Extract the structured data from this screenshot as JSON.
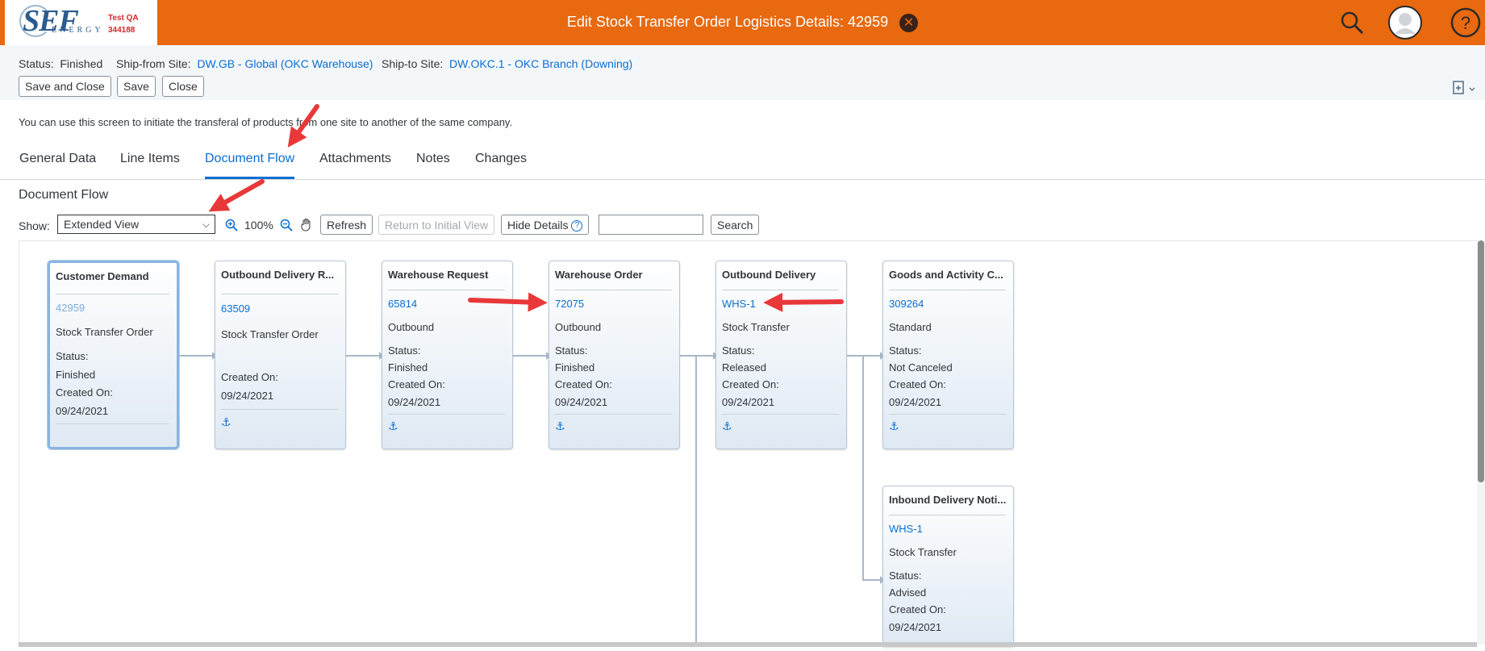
{
  "header": {
    "logo_text": "SEF",
    "logo_subtext": "ENERGY",
    "env_name": "Test QA",
    "env_code": "344188",
    "title": "Edit Stock Transfer Order Logistics Details: 42959",
    "close_icon": "close-circle-icon",
    "icons": [
      "search-icon",
      "user-avatar-icon",
      "help-icon"
    ]
  },
  "object_header": {
    "status_label": "Status:",
    "status_value": "Finished",
    "ship_from_label": "Ship-from Site:",
    "ship_from_value": "DW.GB - Global (OKC Warehouse)",
    "ship_to_label": "Ship-to Site:",
    "ship_to_value": "DW.OKC.1 - OKC Branch (Downing)",
    "buttons": {
      "save_close": "Save and Close",
      "save": "Save",
      "close": "Close"
    }
  },
  "intro_text": "You can use this screen to initiate the transferal of products from one site to another of the same company.",
  "tabs": [
    {
      "label": "General Data"
    },
    {
      "label": "Line Items"
    },
    {
      "label": "Document Flow",
      "active": true
    },
    {
      "label": "Attachments"
    },
    {
      "label": "Notes"
    },
    {
      "label": "Changes"
    }
  ],
  "section_title": "Document Flow",
  "toolbar": {
    "show_label": "Show:",
    "show_value": "Extended View",
    "zoom": "100%",
    "refresh": "Refresh",
    "return_initial": "Return to Initial View",
    "hide_details": "Hide Details",
    "search_value": "",
    "search_button": "Search"
  },
  "nodes": [
    {
      "title": "Customer Demand",
      "id": "42959",
      "type": "Stock Transfer Order",
      "status_label": "Status:",
      "status": "Finished",
      "created_label": "Created On:",
      "created": "09/24/2021"
    },
    {
      "title": "Outbound Delivery R...",
      "id": "63509",
      "type": "Stock Transfer Order",
      "created_label": "Created On:",
      "created": "09/24/2021"
    },
    {
      "title": "Warehouse Request",
      "id": "65814",
      "type": "Outbound",
      "status_label": "Status:",
      "status": "Finished",
      "created_label": "Created On:",
      "created": "09/24/2021"
    },
    {
      "title": "Warehouse Order",
      "id": "72075",
      "type": "Outbound",
      "status_label": "Status:",
      "status": "Finished",
      "created_label": "Created On:",
      "created": "09/24/2021"
    },
    {
      "title": "Outbound Delivery",
      "id": "WHS-1",
      "type": "Stock Transfer",
      "status_label": "Status:",
      "status": "Released",
      "created_label": "Created On:",
      "created": "09/24/2021"
    },
    {
      "title": "Goods and Activity C...",
      "id": "309264",
      "type": "Standard",
      "status_label": "Status:",
      "status": "Not Canceled",
      "created_label": "Created On:",
      "created": "09/24/2021"
    },
    {
      "title": "Inbound Delivery Noti...",
      "id": "WHS-1",
      "type": "Stock Transfer",
      "status_label": "Status:",
      "status": "Advised",
      "created_label": "Created On:",
      "created": "09/24/2021"
    }
  ]
}
